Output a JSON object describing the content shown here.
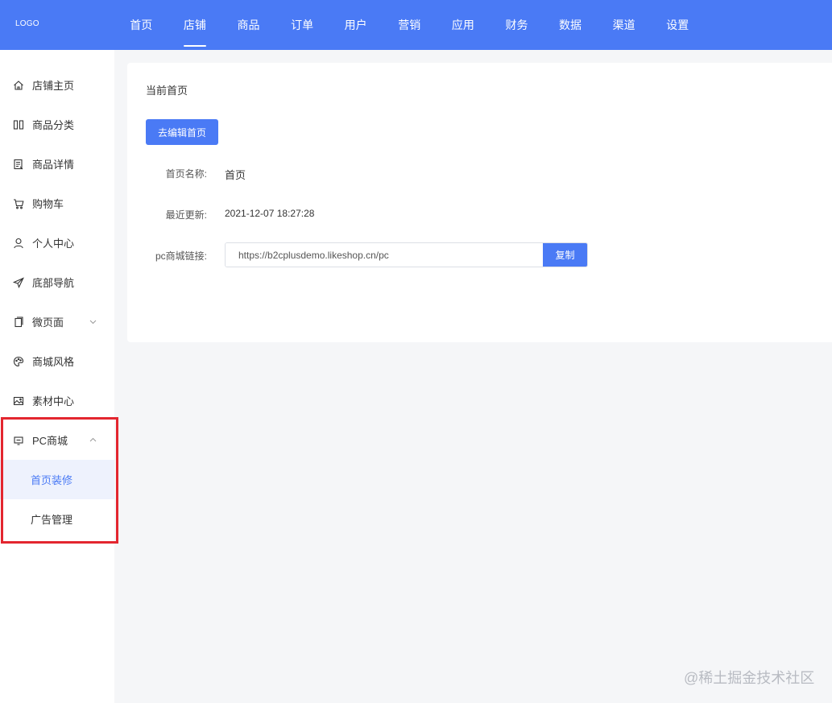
{
  "header": {
    "logo": "LOGO",
    "nav": [
      {
        "label": "首页"
      },
      {
        "label": "店铺",
        "active": true
      },
      {
        "label": "商品"
      },
      {
        "label": "订单"
      },
      {
        "label": "用户"
      },
      {
        "label": "营销"
      },
      {
        "label": "应用"
      },
      {
        "label": "财务"
      },
      {
        "label": "数据"
      },
      {
        "label": "渠道"
      },
      {
        "label": "设置"
      }
    ]
  },
  "sidebar": {
    "items": [
      {
        "label": "店铺主页",
        "icon": "home-icon"
      },
      {
        "label": "商品分类",
        "icon": "category-icon"
      },
      {
        "label": "商品详情",
        "icon": "detail-icon"
      },
      {
        "label": "购物车",
        "icon": "cart-icon"
      },
      {
        "label": "个人中心",
        "icon": "user-icon"
      },
      {
        "label": "底部导航",
        "icon": "send-icon"
      },
      {
        "label": "微页面",
        "icon": "page-icon",
        "expandable": "collapsed"
      },
      {
        "label": "商城风格",
        "icon": "palette-icon"
      },
      {
        "label": "素材中心",
        "icon": "image-icon"
      },
      {
        "label": "PC商城",
        "icon": "monitor-icon",
        "expandable": "expanded"
      }
    ],
    "pc_sub": [
      {
        "label": "首页装修",
        "active": true
      },
      {
        "label": "广告管理"
      }
    ]
  },
  "main": {
    "title": "当前首页",
    "edit_button": "去编辑首页",
    "fields": {
      "name_label": "首页名称:",
      "name_value": "首页",
      "updated_label": "最近更新:",
      "updated_value": "2021-12-07 18:27:28",
      "link_label": "pc商城链接:",
      "link_value": "https://b2cplusdemo.likeshop.cn/pc",
      "copy_button": "复制"
    }
  },
  "watermark": "@稀土掘金技术社区",
  "colors": {
    "primary": "#4a7af5",
    "highlight": "#e3262f",
    "background": "#f5f6f8"
  }
}
